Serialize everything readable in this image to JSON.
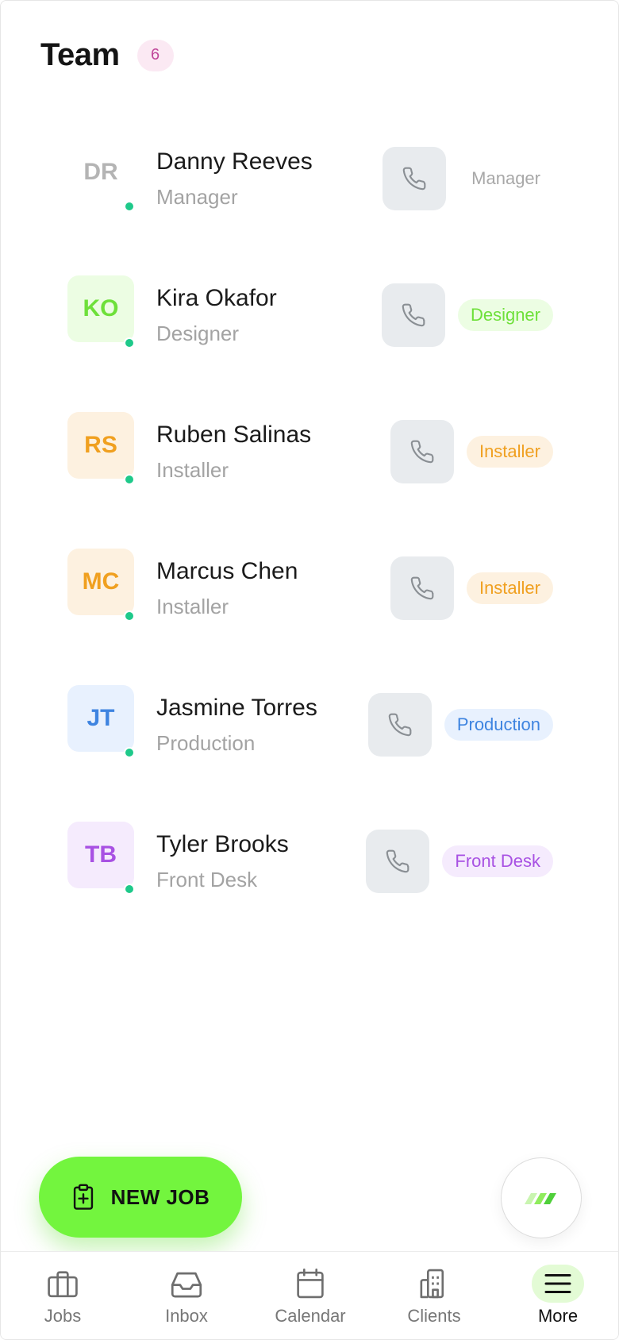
{
  "header": {
    "title": "Team",
    "count": "6"
  },
  "members": [
    {
      "initials": "DR",
      "name": "Danny Reeves",
      "role": "Manager",
      "tag": "Manager",
      "avatar_bg": "#ffffff",
      "avatar_fg": "#b4b4b4",
      "tag_bg": "#ffffff",
      "tag_fg": "#a8a8a8"
    },
    {
      "initials": "KO",
      "name": "Kira Okafor",
      "role": "Designer",
      "tag": "Designer",
      "avatar_bg": "#ecfde3",
      "avatar_fg": "#6ee03a",
      "tag_bg": "#ecfde3",
      "tag_fg": "#6ee03a"
    },
    {
      "initials": "RS",
      "name": "Ruben Salinas",
      "role": "Installer",
      "tag": "Installer",
      "avatar_bg": "#fdf1e0",
      "avatar_fg": "#f0a020",
      "tag_bg": "#fdf1e0",
      "tag_fg": "#f0a020"
    },
    {
      "initials": "MC",
      "name": "Marcus Chen",
      "role": "Installer",
      "tag": "Installer",
      "avatar_bg": "#fdf1e0",
      "avatar_fg": "#f0a020",
      "tag_bg": "#fdf1e0",
      "tag_fg": "#f0a020"
    },
    {
      "initials": "JT",
      "name": "Jasmine Torres",
      "role": "Production",
      "tag": "Production",
      "avatar_bg": "#e8f1fe",
      "avatar_fg": "#3e84e0",
      "tag_bg": "#e8f1fe",
      "tag_fg": "#3e84e0"
    },
    {
      "initials": "TB",
      "name": "Tyler Brooks",
      "role": "Front Desk",
      "tag": "Front Desk",
      "avatar_bg": "#f5ebfd",
      "avatar_fg": "#a851e3",
      "tag_bg": "#f5ebfd",
      "tag_fg": "#a851e3"
    }
  ],
  "fab": {
    "label": "NEW JOB",
    "icon": "clipboard-plus-icon"
  },
  "assistant": {
    "icon": "stripes-logo-icon"
  },
  "nav": [
    {
      "label": "Jobs",
      "icon": "briefcase-icon",
      "active": false
    },
    {
      "label": "Inbox",
      "icon": "inbox-icon",
      "active": false
    },
    {
      "label": "Calendar",
      "icon": "calendar-icon",
      "active": false
    },
    {
      "label": "Clients",
      "icon": "building-icon",
      "active": false
    },
    {
      "label": "More",
      "icon": "menu-icon",
      "active": true
    }
  ],
  "colors": {
    "accent": "#73f53e",
    "online": "#1ec98a",
    "call_bg": "#e8ebee"
  }
}
